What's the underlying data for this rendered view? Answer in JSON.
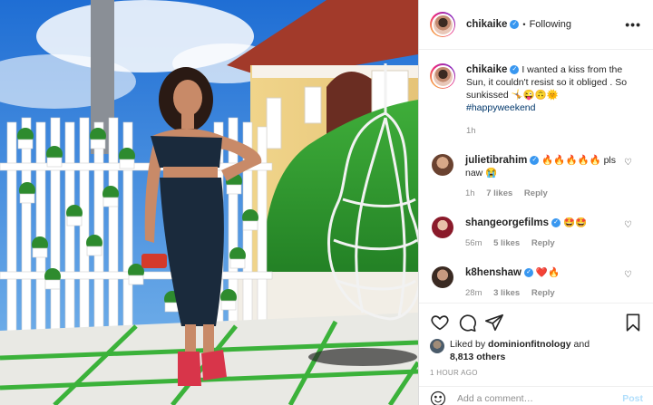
{
  "post": {
    "photo_alt": "Photo",
    "header": {
      "username": "chikaike",
      "separator": "•",
      "follow_status": "Following",
      "more": "•••"
    },
    "caption": {
      "username": "chikaike",
      "text": "I wanted a kiss from the Sun, it couldn't resist so it obliged . So sunkissed 🤸😜🙃🌞",
      "hashtag": "#happyweekend",
      "time": "1h"
    },
    "comments": [
      {
        "username": "julietibrahim",
        "verified": true,
        "text": "🔥🔥🔥🔥🔥 pls naw 😭",
        "time": "1h",
        "likes": "7 likes",
        "reply": "Reply",
        "avatar_color": "#b07a5a"
      },
      {
        "username": "shangeorgefilms",
        "verified": true,
        "text": "🤩🤩",
        "time": "56m",
        "likes": "5 likes",
        "reply": "Reply",
        "avatar_color": "#8a1a2a"
      },
      {
        "username": "k8henshaw",
        "verified": true,
        "text": "❤️🔥",
        "time": "28m",
        "likes": "3 likes",
        "reply": "Reply",
        "avatar_color": "#5a4030"
      }
    ],
    "likes": {
      "prefix": "Liked by",
      "user": "dominionfitnology",
      "joiner": "and",
      "others": "8,813 others"
    },
    "time_ago": "1 HOUR AGO",
    "add_comment": {
      "placeholder": "Add a comment…",
      "post_label": "Post"
    },
    "colors": {
      "verified": "#3897f0",
      "hashtag": "#00376b",
      "muted": "#8e8e8e",
      "post_disabled": "#b2dffc",
      "border": "#dbdbdb"
    }
  }
}
